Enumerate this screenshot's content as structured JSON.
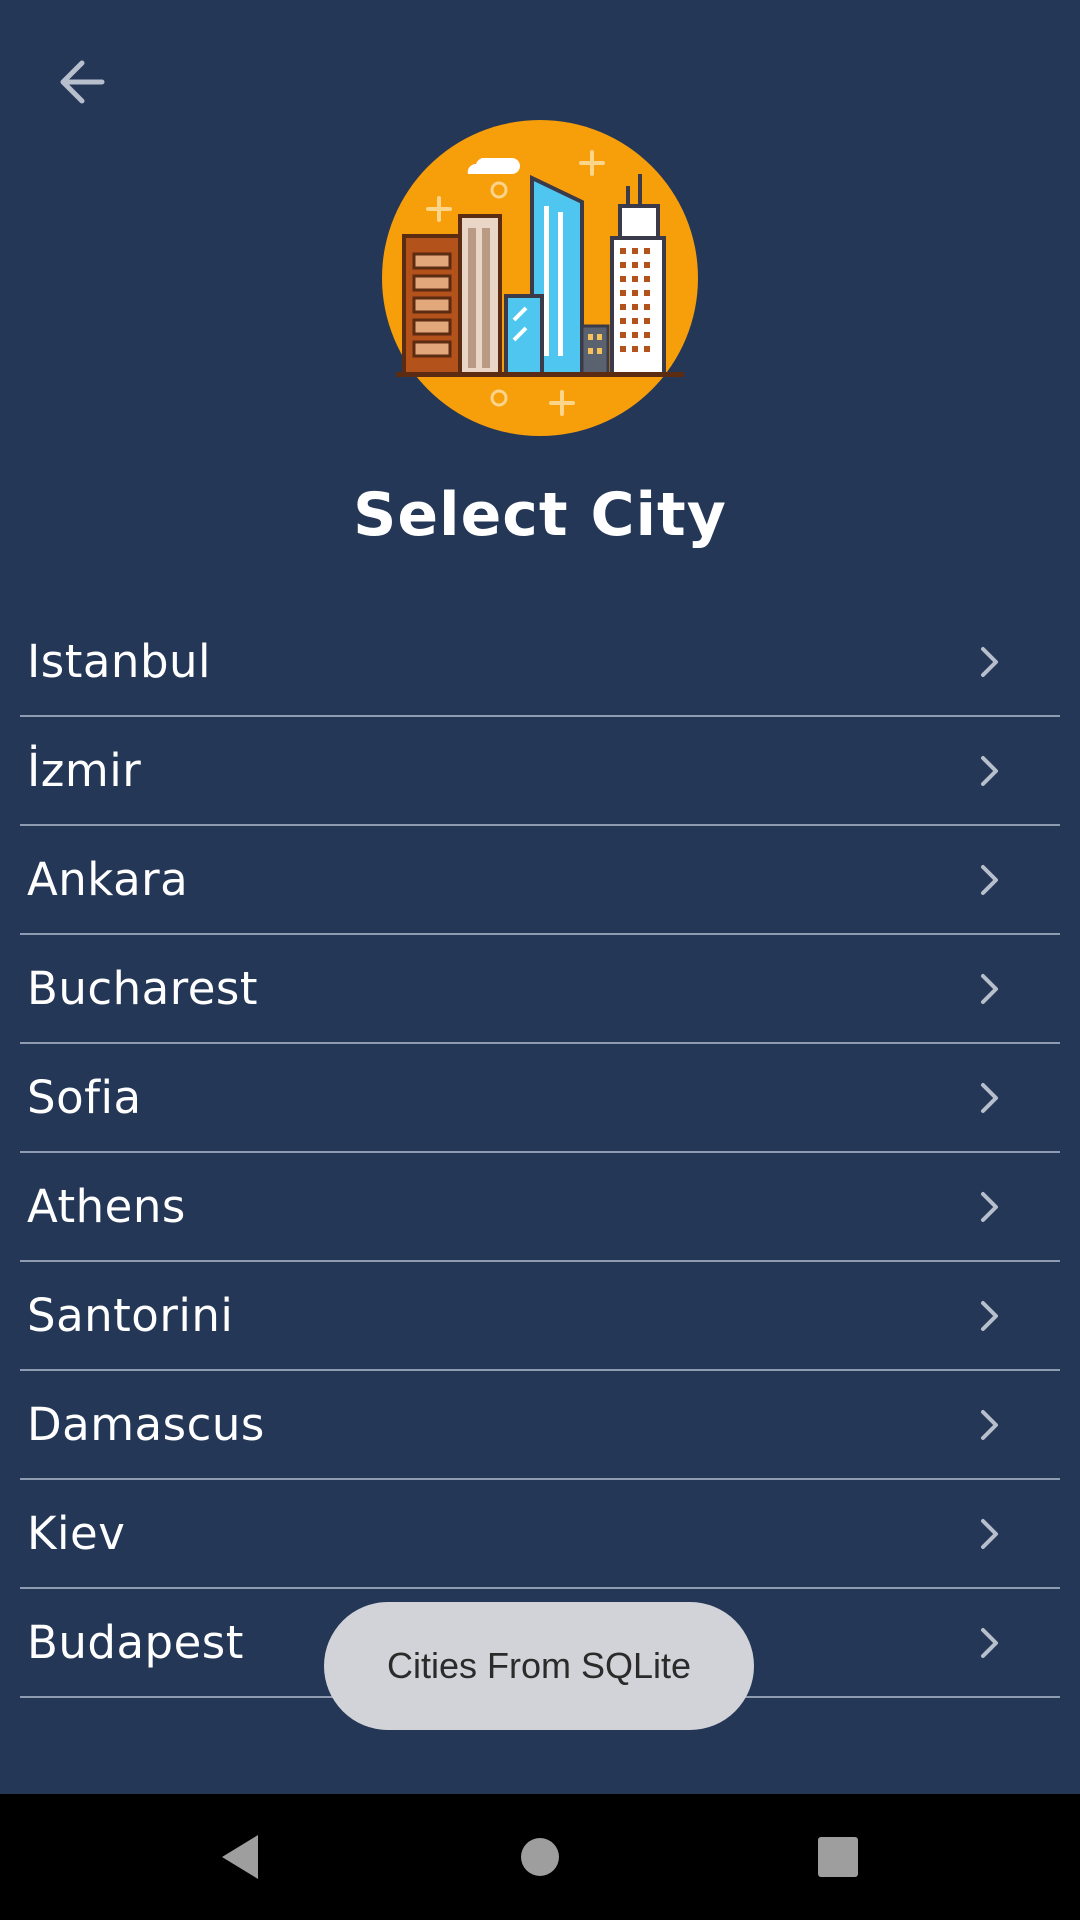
{
  "header": {
    "back_icon": "arrow-left-icon",
    "logo_icon": "city-buildings-icon",
    "title": "Select City"
  },
  "cities": [
    {
      "name": "Istanbul"
    },
    {
      "name": "İzmir"
    },
    {
      "name": "Ankara"
    },
    {
      "name": "Bucharest"
    },
    {
      "name": "Sofia"
    },
    {
      "name": "Athens"
    },
    {
      "name": "Santorini"
    },
    {
      "name": "Damascus"
    },
    {
      "name": "Kiev"
    },
    {
      "name": "Budapest"
    }
  ],
  "row_icon": "chevron-right-icon",
  "toast": {
    "text": "Cities From SQLite"
  },
  "navigation_bar": {
    "back": "triangle-back-icon",
    "home": "circle-home-icon",
    "recents": "square-recents-icon"
  },
  "colors": {
    "background": "#253757",
    "logo_circle": "#F79E0B",
    "divider": "#8F9BB0",
    "toast_background": "#D2D3D8",
    "nav_bar": "#000000"
  }
}
